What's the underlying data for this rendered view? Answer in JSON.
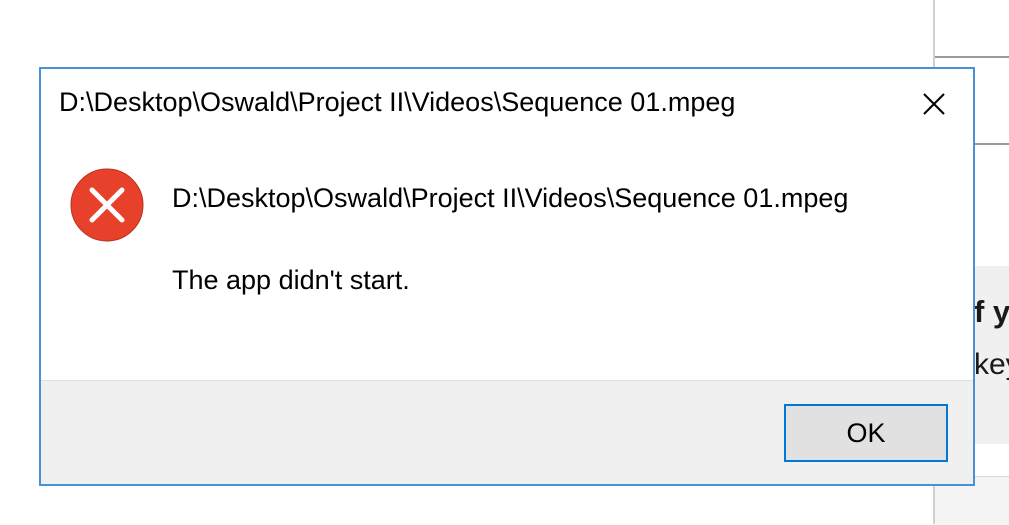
{
  "dialog": {
    "title": "D:\\Desktop\\Oswald\\Project II\\Videos\\Sequence 01.mpeg",
    "close_icon": "close-icon",
    "icon": "error-icon",
    "icon_color": "#e8412b",
    "message_path": "D:\\Desktop\\Oswald\\Project II\\Videos\\Sequence 01.mpeg",
    "message_text": "The app didn't start.",
    "ok_label": "OK",
    "accent_color": "#0078d7"
  },
  "background_window": {
    "heading_fragment": "f y",
    "text_fragment": "key"
  }
}
